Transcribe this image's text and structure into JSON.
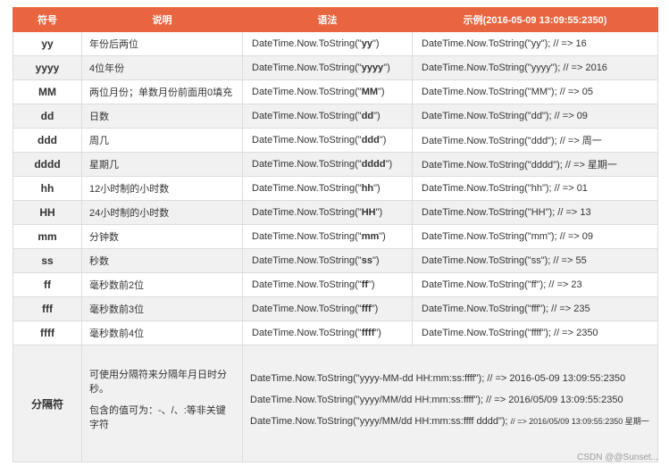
{
  "headers": [
    "符号",
    "说明",
    "语法",
    "示例(2016-05-09 13:09:55:2350)"
  ],
  "rows": [
    {
      "symbol": "yy",
      "desc": "年份后两位",
      "syn_pre": "DateTime.Now.ToString(\"",
      "syn_code": "yy",
      "syn_post": "\")",
      "example": "DateTime.Now.ToString(\"yy\"); // => 16"
    },
    {
      "symbol": "yyyy",
      "desc": "4位年份",
      "syn_pre": "DateTime.Now.ToString(\"",
      "syn_code": "yyyy",
      "syn_post": "\")",
      "example": "DateTime.Now.ToString(\"yyyy\"); // => 2016"
    },
    {
      "symbol": "MM",
      "desc": "两位月份；单数月份前面用0填充",
      "syn_pre": "DateTime.Now.ToString(\"",
      "syn_code": "MM",
      "syn_post": "\")",
      "example": "DateTime.Now.ToString(\"MM\"); // => 05"
    },
    {
      "symbol": "dd",
      "desc": "日数",
      "syn_pre": "DateTime.Now.ToString(\"",
      "syn_code": "dd",
      "syn_post": "\")",
      "example": "DateTime.Now.ToString(\"dd\"); // => 09"
    },
    {
      "symbol": "ddd",
      "desc": "周几",
      "syn_pre": "DateTime.Now.ToString(\"",
      "syn_code": "ddd",
      "syn_post": "\")",
      "example": "DateTime.Now.ToString(\"ddd\"); // => 周一"
    },
    {
      "symbol": "dddd",
      "desc": "星期几",
      "syn_pre": "DateTime.Now.ToString(\"",
      "syn_code": "dddd",
      "syn_post": "\")",
      "example": "DateTime.Now.ToString(\"dddd\"); // => 星期一"
    },
    {
      "symbol": "hh",
      "desc": "12小时制的小时数",
      "syn_pre": "DateTime.Now.ToString(\"",
      "syn_code": "hh",
      "syn_post": "\")",
      "example": "DateTime.Now.ToString(\"hh\"); // => 01"
    },
    {
      "symbol": "HH",
      "desc": "24小时制的小时数",
      "syn_pre": "DateTime.Now.ToString(\"",
      "syn_code": "HH",
      "syn_post": "\")",
      "example": "DateTime.Now.ToString(\"HH\"); // => 13"
    },
    {
      "symbol": "mm",
      "desc": "分钟数",
      "syn_pre": "DateTime.Now.ToString(\"",
      "syn_code": "mm",
      "syn_post": "\")",
      "example": "DateTime.Now.ToString(\"mm\"); // => 09"
    },
    {
      "symbol": "ss",
      "desc": "秒数",
      "syn_pre": "DateTime.Now.ToString(\"",
      "syn_code": "ss",
      "syn_post": "\")",
      "example": "DateTime.Now.ToString(\"ss\"); // => 55"
    },
    {
      "symbol": "ff",
      "desc": "毫秒数前2位",
      "syn_pre": "DateTime.Now.ToString(\"",
      "syn_code": "ff",
      "syn_post": "\")",
      "example": "DateTime.Now.ToString(\"ff\"); // => 23"
    },
    {
      "symbol": "fff",
      "desc": "毫秒数前3位",
      "syn_pre": "DateTime.Now.ToString(\"",
      "syn_code": "fff",
      "syn_post": "\")",
      "example": "DateTime.Now.ToString(\"fff\"); // => 235"
    },
    {
      "symbol": "ffff",
      "desc": "毫秒数前4位",
      "syn_pre": "DateTime.Now.ToString(\"",
      "syn_code": "ffff",
      "syn_post": "\")",
      "example": "DateTime.Now.ToString(\"ffff\"); // => 2350"
    }
  ],
  "separator": {
    "symbol": "分隔符",
    "desc_1": "可使用分隔符来分隔年月日时分秒。",
    "desc_2": "包含的值可为：-、/、:等非关键字符",
    "ex_1": "DateTime.Now.ToString(\"yyyy-MM-dd HH:mm:ss:ffff\"); // => 2016-05-09 13:09:55:2350",
    "ex_2": "DateTime.Now.ToString(\"yyyy/MM/dd HH:mm:ss:ffff\"); // => 2016/05/09 13:09:55:2350",
    "ex_3_main": "DateTime.Now.ToString(\"yyyy/MM/dd HH:mm:ss:ffff dddd\"); ",
    "ex_3_result": "// => 2016/05/09 13:09:55:2350 星期一"
  },
  "watermark": "CSDN @@Sunset..."
}
